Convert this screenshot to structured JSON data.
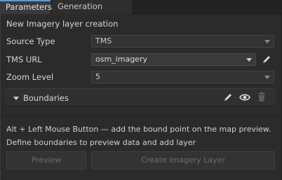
{
  "tabs": [
    {
      "label": "Parameters",
      "active": true
    },
    {
      "label": "Generation Settings",
      "active": false
    }
  ],
  "section_title": "New Imagery layer creation",
  "fields": {
    "source_type": {
      "label": "Source Type",
      "value": "TMS"
    },
    "tms_url": {
      "label": "TMS URL",
      "value": "osm_imagery"
    },
    "zoom_level": {
      "label": "Zoom Level",
      "value": "5"
    }
  },
  "boundaries": {
    "label": "Boundaries"
  },
  "notes": {
    "hint": "Alt + Left Mouse Button — add the bound point on the map preview.",
    "instruction": "Define boundaries to preview data and add layer"
  },
  "buttons": {
    "preview": "Preview",
    "create": "Create Imagery Layer"
  },
  "icons": {
    "edit": "pencil-icon",
    "visibility": "eye-icon",
    "delete": "trash-icon",
    "dropdown": "chevron-down-icon",
    "expand": "triangle-down-icon"
  },
  "colors": {
    "accent": "#5a9bd5",
    "background": "#2b2b2b",
    "field": "#3a3a3a"
  }
}
